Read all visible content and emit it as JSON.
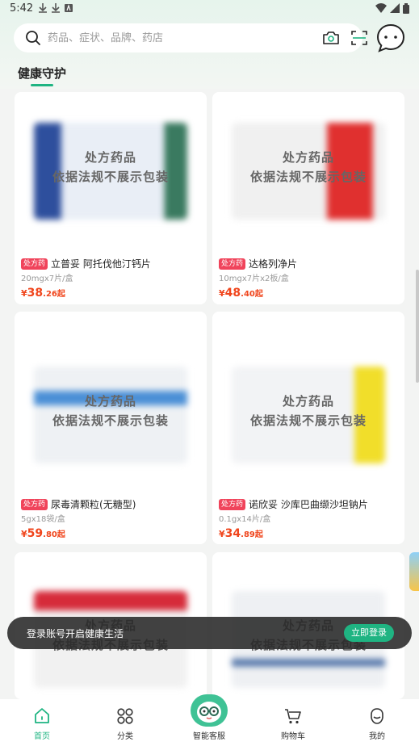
{
  "status_bar": {
    "time": "5:42"
  },
  "search": {
    "placeholder": "药品、症状、品牌、药店"
  },
  "section": {
    "title": "健康守护"
  },
  "notice": {
    "line1": "处方药品",
    "line2": "依据法规不展示包装"
  },
  "products": [
    {
      "badge": "处方药",
      "name": "立普妥 阿托伐他汀钙片",
      "spec": "20mgx7片/盒",
      "currency": "¥",
      "price_int": "38",
      "price_dec": ".26起",
      "box_color": "#3a5aa8"
    },
    {
      "badge": "处方药",
      "name": "达格列净片",
      "spec": "10mgx7片x2板/盒",
      "currency": "¥",
      "price_int": "48",
      "price_dec": ".40起",
      "box_color": "#e0302f"
    },
    {
      "badge": "处方药",
      "name": "尿毒清颗粒(无糖型)",
      "spec": "5gx18袋/盒",
      "currency": "¥",
      "price_int": "59",
      "price_dec": ".80起",
      "box_color": "#4a8fd6"
    },
    {
      "badge": "处方药",
      "name": "诺欣妥 沙库巴曲缬沙坦钠片",
      "spec": "0.1gx14片/盒",
      "currency": "¥",
      "price_int": "34",
      "price_dec": ".89起",
      "box_color": "#f1de2a"
    },
    {
      "badge": "",
      "name": "",
      "spec": "",
      "currency": "",
      "price_int": "",
      "price_dec": "",
      "box_color": "#d62b3a"
    },
    {
      "badge": "",
      "name": "",
      "spec": "",
      "currency": "",
      "price_int": "",
      "price_dec": "",
      "box_color": "#5577aa"
    }
  ],
  "toast": {
    "text": "登录账号开启健康生活",
    "button": "立即登录"
  },
  "nav": [
    {
      "label": "首页",
      "icon": "home-icon",
      "active": true
    },
    {
      "label": "分类",
      "icon": "category-icon",
      "active": false
    },
    {
      "label": "智能客服",
      "icon": "assistant-icon",
      "active": false
    },
    {
      "label": "购物车",
      "icon": "cart-icon",
      "active": false
    },
    {
      "label": "我的",
      "icon": "profile-icon",
      "active": false
    }
  ],
  "colors": {
    "accent": "#1fb482",
    "price": "#f0451c",
    "rx_badge": "#f0445b"
  }
}
